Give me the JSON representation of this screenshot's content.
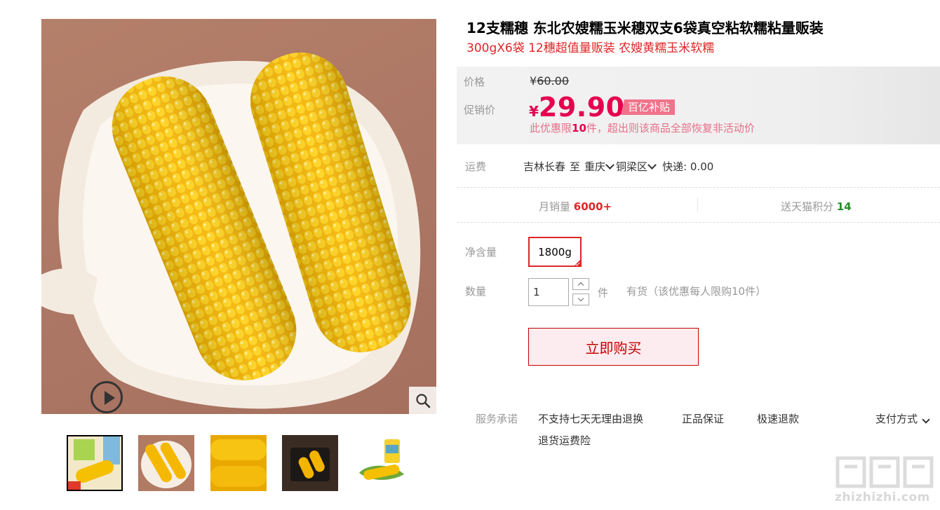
{
  "product": {
    "title": "12支糯穗 东北农嫂糯玉米穗双支6袋真空粘软糯粘量贩装",
    "subtitle": "300gX6袋 12穗超值量贩装 农嫂黄糯玉米软糯"
  },
  "price": {
    "label_original": "价格",
    "label_promo": "促销价",
    "currency": "¥",
    "original": "60.00",
    "promo": "29.90",
    "badge": "百亿补贴",
    "limit_note_prefix": "此优惠限",
    "limit_note_count": "10",
    "limit_note_suffix": "件，超出则该商品全部恢复非活动价"
  },
  "shipping": {
    "label": "运费",
    "origin": "吉林长春",
    "to": "至",
    "city": "重庆",
    "district": "铜梁区",
    "express": "快递: 0.00"
  },
  "stats": {
    "monthly_sales_label": "月销量",
    "monthly_sales_value": "6000+",
    "points_label": "送天猫积分",
    "points_value": "14"
  },
  "options": {
    "net_label": "净含量",
    "net_selected": "1800g"
  },
  "quantity": {
    "label": "数量",
    "value": "1",
    "unit": "件",
    "stock": "有货（该优惠每人限购10件）"
  },
  "buy_button": "立即购买",
  "service": {
    "label": "服务承诺",
    "items": [
      "不支持七天无理由退换",
      "正品保证",
      "极速退款",
      "退货运费险"
    ],
    "payment": "支付方式"
  },
  "watermark": "zhizhizhi.com",
  "colors": {
    "accent": "#dd2727",
    "promo_price": "#e5004f",
    "badge_bg": "#f0738b",
    "buy_bg": "#fdecef",
    "points": "#2a8b2a"
  },
  "icons": [
    "play-icon",
    "zoom-icon",
    "chevron-down-icon",
    "check-icon"
  ],
  "thumbnails": 5
}
